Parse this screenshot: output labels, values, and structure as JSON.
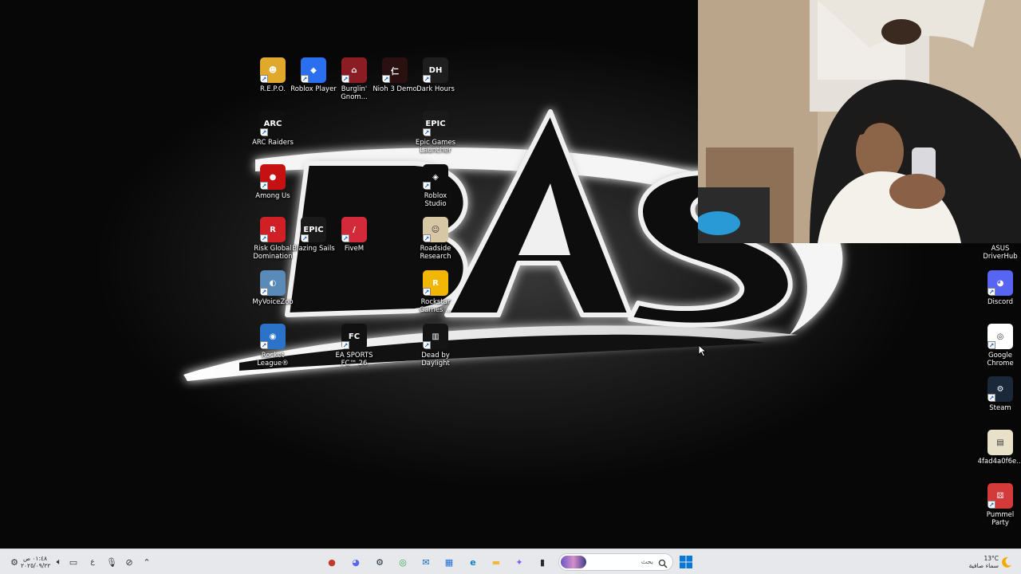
{
  "desktop": {
    "icons": [
      {
        "label": "R.E.P.O.",
        "icon": "repo-icon",
        "color": "#e0a92b"
      },
      {
        "label": "Roblox Player",
        "icon": "roblox-icon",
        "color": "#2a6ff0"
      },
      {
        "label": "Burglin' Gnom...",
        "icon": "burglin-gnomes-icon",
        "color": "#8b1c24"
      },
      {
        "label": "Nioh 3 Demo",
        "icon": "nioh-icon",
        "color": "#2a1010"
      },
      {
        "label": "Dark Hours",
        "icon": "dark-hours-icon",
        "color": "#1e1e1e"
      },
      {
        "label": "ARC Raiders",
        "icon": "arc-raiders-icon",
        "color": "#101010"
      },
      {
        "label": "Epic Games Launcher",
        "icon": "epic-games-icon",
        "color": "#1a1a1a"
      },
      {
        "label": "Among Us",
        "icon": "among-us-icon",
        "color": "#c51111"
      },
      {
        "label": "Roblox Studio",
        "icon": "roblox-studio-icon",
        "color": "#0d0d0d"
      },
      {
        "label": "Risk Global Domination",
        "icon": "risk-icon",
        "color": "#d01f25"
      },
      {
        "label": "Blazing Sails",
        "icon": "epic-games-icon",
        "color": "#1a1a1a"
      },
      {
        "label": "FiveM",
        "icon": "fivem-icon",
        "color": "#d2293b"
      },
      {
        "label": "Roadside Research",
        "icon": "roadside-research-icon",
        "color": "#d8c7a4"
      },
      {
        "label": "MyVoiceZoo",
        "icon": "myvoicezoo-icon",
        "color": "#5a8bb8"
      },
      {
        "label": "Rockstar Games ...",
        "icon": "rockstar-icon",
        "color": "#f2b705"
      },
      {
        "label": "Rocket League®",
        "icon": "rocket-league-icon",
        "color": "#2a73c9"
      },
      {
        "label": "EA SPORTS FC™ 26",
        "icon": "ea-fc-icon",
        "color": "#111111"
      },
      {
        "label": "Dead by Daylight",
        "icon": "dead-by-daylight-icon",
        "color": "#141414"
      },
      {
        "label": "ASUS DriverHub",
        "icon": "asus-icon",
        "color": "#222222"
      },
      {
        "label": "Discord",
        "icon": "discord-icon",
        "color": "#5865f2"
      },
      {
        "label": "Google Chrome",
        "icon": "chrome-icon",
        "color": "#ffffff"
      },
      {
        "label": "Steam",
        "icon": "steam-icon",
        "color": "#1b2838"
      },
      {
        "label": "4fad4a0f6e...",
        "icon": "image-file-icon",
        "color": "#e8e0c8"
      },
      {
        "label": "Pummel Party",
        "icon": "pummel-party-icon",
        "color": "#d33a3a"
      }
    ],
    "icon_glyphs": [
      "☻",
      "◆",
      "⌂",
      "仁",
      "DH",
      "ARC",
      "EPIC",
      "●",
      "◈",
      "R",
      "EPIC",
      "/",
      "☺",
      "◐",
      "R",
      "◉",
      "FC",
      "▥",
      "",
      "◕",
      "◎",
      "⚙",
      "▤",
      "⚄"
    ]
  },
  "taskbar": {
    "clock": {
      "time": "٠١:٤٨ ص",
      "date": "٢٠٢٥/٠٩/٢٢"
    },
    "language": "ع",
    "search_placeholder": "بحث",
    "weather": {
      "temp": "13°C",
      "condition": "سماء صافية"
    },
    "apps": [
      {
        "name": "record-app",
        "color": "#c0392b"
      },
      {
        "name": "discord",
        "color": "#5865f2"
      },
      {
        "name": "steam",
        "color": "#1b2838"
      },
      {
        "name": "chrome",
        "color": "#34a853"
      },
      {
        "name": "outlook",
        "color": "#0f6cbd"
      },
      {
        "name": "store",
        "color": "#1e6fd9"
      },
      {
        "name": "edge",
        "color": "#0a84c6"
      },
      {
        "name": "file-explorer",
        "color": "#f4b73d"
      },
      {
        "name": "copilot",
        "color": "#8a5cf5"
      },
      {
        "name": "terminal",
        "color": "#2b2b2b"
      }
    ]
  },
  "wallpaper": {
    "text": "BAS"
  },
  "colors": {
    "taskbar_bg": "#e7e8ec",
    "start_blue": "#0a78d7"
  }
}
